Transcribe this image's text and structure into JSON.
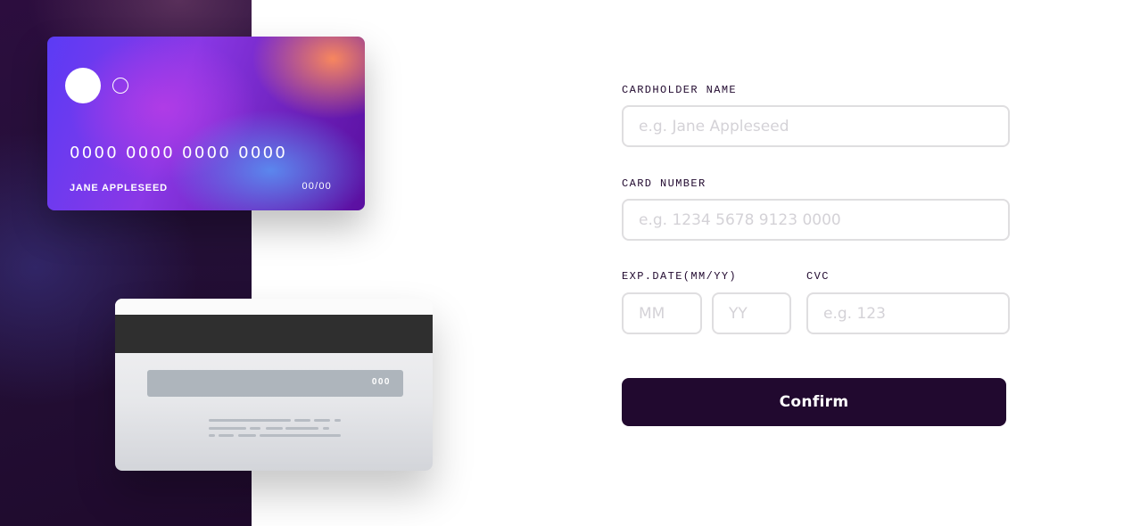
{
  "card_front": {
    "number": "0000 0000 0000 0000",
    "holder": "JANE APPLESEED",
    "expiry": "00/00"
  },
  "card_back": {
    "cvc": "000"
  },
  "form": {
    "cardholder_label": "CARDHOLDER NAME",
    "cardholder_placeholder": "e.g. Jane Appleseed",
    "number_label": "CARD NUMBER",
    "number_placeholder": "e.g. 1234 5678 9123 0000",
    "exp_label": "EXP.DATE(MM/YY)",
    "month_placeholder": "MM",
    "year_placeholder": "YY",
    "cvc_label": "CVC",
    "cvc_placeholder": "e.g. 123",
    "confirm_label": "Confirm"
  },
  "colors": {
    "dark_violet": "#21092f",
    "border_gray": "#dfdee0",
    "placeholder_gray": "#d4d2d7"
  }
}
